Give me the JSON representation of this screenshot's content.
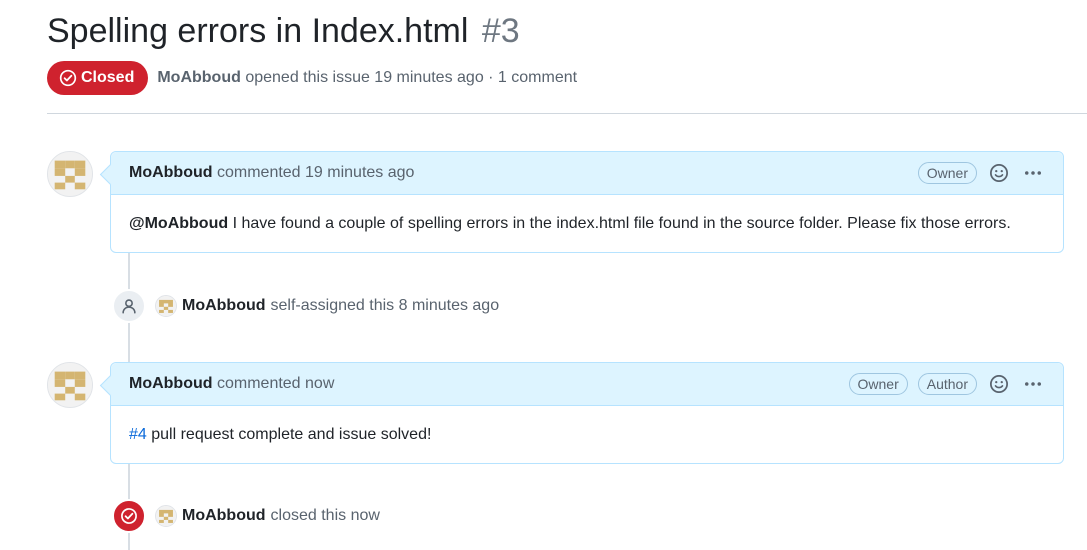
{
  "issue": {
    "title": "Spelling errors in Index.html",
    "number": "#3",
    "state": "Closed",
    "state_color": "#cf222e",
    "author": "MoAbboud",
    "opened_text": "opened this issue 19 minutes ago · 1 comment"
  },
  "comments": [
    {
      "author": "MoAbboud",
      "time_text": "commented 19 minutes ago",
      "labels": [
        "Owner"
      ],
      "mention": "@MoAbboud",
      "body": " I have found a couple of spelling errors in the index.html file found in the source folder. Please fix those errors.",
      "reaction_icon": "smiley-icon",
      "menu_icon": "kebab-horizontal-icon"
    },
    {
      "author": "MoAbboud",
      "time_text": "commented now",
      "labels": [
        "Owner",
        "Author"
      ],
      "link_text": "#4",
      "body": " pull request complete and issue solved!",
      "reaction_icon": "smiley-icon",
      "menu_icon": "kebab-horizontal-icon"
    }
  ],
  "events": [
    {
      "icon": "person-icon",
      "author": "MoAbboud",
      "text": "self-assigned this 8 minutes ago"
    },
    {
      "icon": "issue-closed-icon",
      "author": "MoAbboud",
      "text": "closed this now"
    }
  ],
  "colors": {
    "accent_blue": "#0969da",
    "comment_header_bg": "#ddf4ff",
    "comment_border": "#b6e3ff"
  }
}
